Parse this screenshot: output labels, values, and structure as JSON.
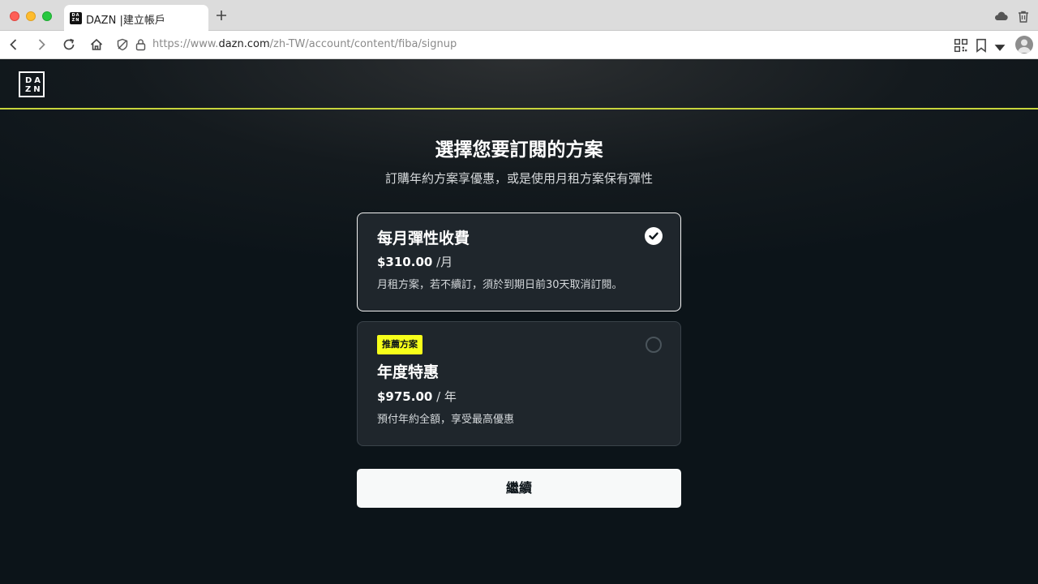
{
  "browser": {
    "tab_title": "DAZN |建立帳戶",
    "url_prefix": "https://www.",
    "url_host": "dazn.com",
    "url_path": "/zh-TW/account/content/fiba/signup"
  },
  "site": {
    "logo_line1": "DA",
    "logo_line2": "ZN"
  },
  "main": {
    "title": "選擇您要訂閱的方案",
    "subtitle": "訂購年約方案享優惠，或是使用月租方案保有彈性"
  },
  "plans": [
    {
      "name": "每月彈性收費",
      "price": "$310.00",
      "unit": "/月",
      "description": "月租方案，若不續訂，須於到期日前30天取消訂閱。",
      "selected": true
    },
    {
      "badge": "推薦方案",
      "name": "年度特惠",
      "price": "$975.00",
      "unit": "/ 年",
      "description": "預付年約全額，享受最高優惠",
      "selected": false
    }
  ],
  "continue_label": "繼續",
  "colors": {
    "accent_line": "#c7d43c",
    "badge_bg": "#f7ff1a",
    "page_bg": "#0c1419",
    "card_bg": "#1f262c"
  },
  "icons": [
    "back-icon",
    "forward-icon",
    "reload-icon",
    "home-icon",
    "shield-icon",
    "lock-icon",
    "qr-icon",
    "bookmark-icon",
    "chevron-down-icon",
    "cloud-icon",
    "trash-icon",
    "plus-icon",
    "check-icon"
  ]
}
